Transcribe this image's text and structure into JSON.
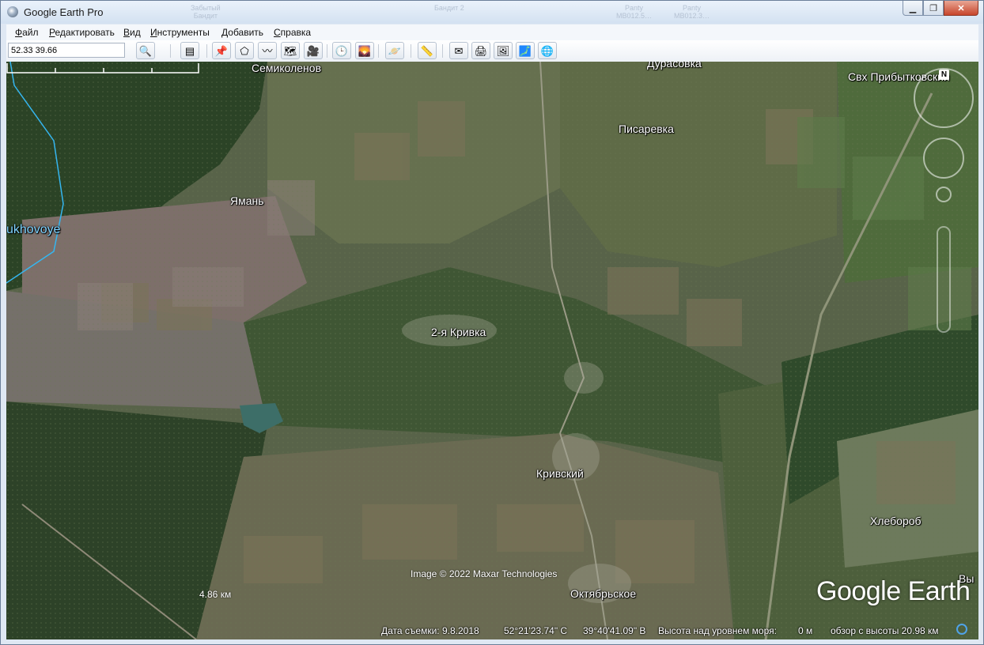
{
  "window": {
    "title": "Google Earth Pro",
    "ghost_titles": [
      "Забытый\nБандит",
      "Бандит 2",
      "Panty\nMB012.5…",
      "Panty\nMB012.3…"
    ]
  },
  "menu": {
    "items": [
      {
        "first": "Ф",
        "rest": "айл"
      },
      {
        "first": "Р",
        "rest": "едактировать"
      },
      {
        "first": "В",
        "rest": "ид"
      },
      {
        "first": "И",
        "rest": "нструменты"
      },
      {
        "first": "Д",
        "rest": "обавить"
      },
      {
        "first": "С",
        "rest": "правка"
      }
    ]
  },
  "toolbar": {
    "search_value": "52.33 39.66",
    "buttons": [
      {
        "name": "search-button",
        "icon": "🔍"
      },
      {
        "name": "sidebar-toggle-button",
        "icon": "▤"
      },
      {
        "name": "add-placemark-button",
        "icon": "📌"
      },
      {
        "name": "add-polygon-button",
        "icon": "⬠"
      },
      {
        "name": "add-path-button",
        "icon": "〰"
      },
      {
        "name": "add-overlay-button",
        "icon": "🗺"
      },
      {
        "name": "record-tour-button",
        "icon": "🎥"
      },
      {
        "name": "historical-imagery-button",
        "icon": "🕒"
      },
      {
        "name": "sunlight-button",
        "icon": "🌄"
      },
      {
        "name": "planets-button",
        "icon": "🪐"
      },
      {
        "name": "ruler-button",
        "icon": "📏"
      },
      {
        "name": "email-button",
        "icon": "✉"
      },
      {
        "name": "print-button",
        "icon": "🖨"
      },
      {
        "name": "save-image-button",
        "icon": "🖼"
      },
      {
        "name": "view-in-maps-button",
        "icon": "🗾"
      },
      {
        "name": "sign-in-button",
        "icon": "🌐"
      }
    ]
  },
  "map": {
    "labels": [
      {
        "text": "Семиколенов"
      },
      {
        "text": "Дурасовка"
      },
      {
        "text": "Свх Прибытковский"
      },
      {
        "text": "Писаревка"
      },
      {
        "text": "Ямань"
      },
      {
        "text": "ukhovoye"
      },
      {
        "text": "2-я Кривка"
      },
      {
        "text": "Кривский"
      },
      {
        "text": "Хлебороб"
      },
      {
        "text": "Октябрьское"
      },
      {
        "text": "Вы"
      }
    ],
    "credit": "Image © 2022 Maxar Technologies",
    "logo": "Google Earth",
    "scale": "4.86 км",
    "north_letter": "N"
  },
  "status": {
    "date": "Дата съемки: 9.8.2018",
    "lat": "52°21'23.74\" С",
    "lon": "39°40'41.09\" В",
    "elevation_label": "Высота над уровнем моря:",
    "elevation_value": "0 м",
    "eye_alt": "обзор с высоты  20.98 км"
  }
}
